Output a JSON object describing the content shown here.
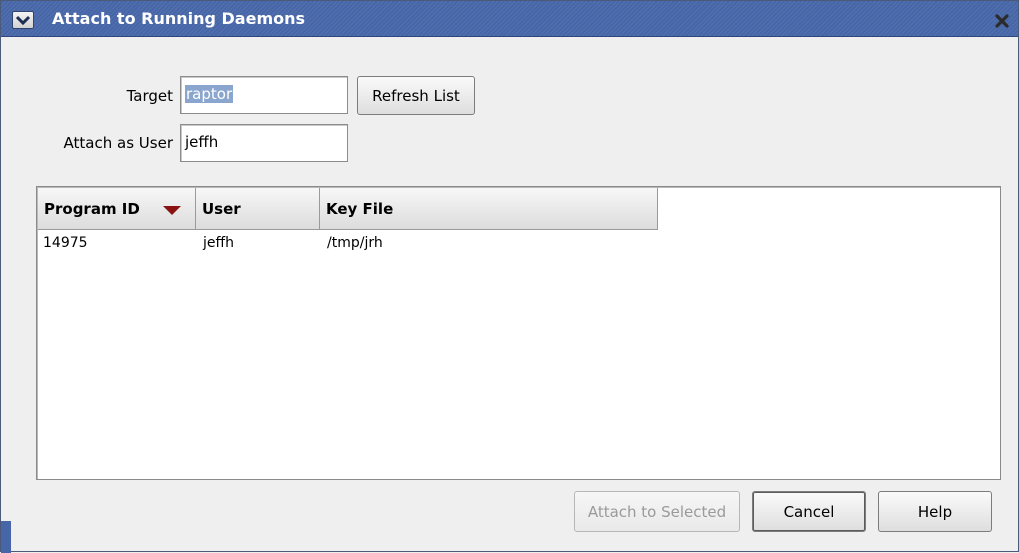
{
  "window": {
    "title": "Attach to Running Daemons",
    "menu_icon": "chevron-down-icon",
    "close_icon": "close-icon"
  },
  "form": {
    "target_label": "Target",
    "target_value": "raptor",
    "refresh_label": "Refresh List",
    "user_label": "Attach as User",
    "user_value": "jeffh"
  },
  "table": {
    "columns": [
      "Program ID",
      "User",
      "Key File"
    ],
    "sort_column": "Program ID",
    "sort_direction": "descending",
    "rows": [
      {
        "program_id": "14975",
        "user": "jeffh",
        "key_file": "/tmp/jrh"
      }
    ]
  },
  "buttons": {
    "attach_label": "Attach to Selected",
    "cancel_label": "Cancel",
    "help_label": "Help"
  },
  "colors": {
    "titlebar": "#4766a8",
    "sort_arrow": "#8b1212",
    "selection": "#8aa6cf"
  }
}
